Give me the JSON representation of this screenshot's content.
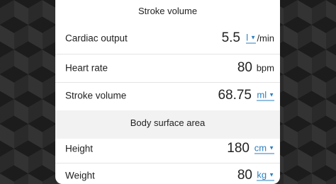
{
  "sections": {
    "stroke_volume_header": "Stroke volume",
    "body_surface_header": "Body surface area"
  },
  "rows": {
    "cardiac_output": {
      "label": "Cardiac output",
      "value": "5.5",
      "unit": "l",
      "unit_suffix": "/min"
    },
    "heart_rate": {
      "label": "Heart rate",
      "value": "80",
      "unit": "bpm"
    },
    "stroke_volume": {
      "label": "Stroke volume",
      "value": "68.75",
      "unit": "ml"
    },
    "height": {
      "label": "Height",
      "value": "180",
      "unit": "cm"
    },
    "weight": {
      "label": "Weight",
      "value": "80",
      "unit": "kg"
    }
  },
  "icons": {
    "dropdown": "caret-down-icon"
  },
  "colors": {
    "link": "#2a7fc1"
  }
}
